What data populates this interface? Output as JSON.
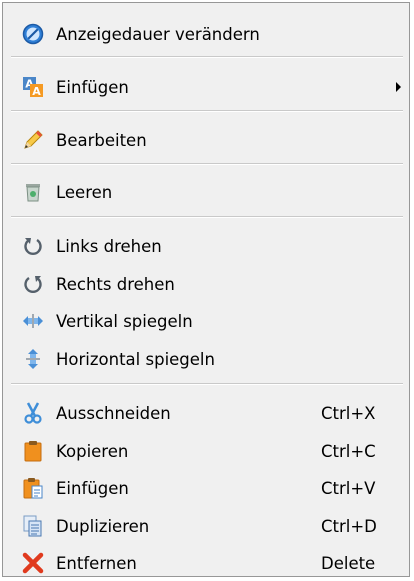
{
  "menu": {
    "items": [
      {
        "label": "Anzeigedauer verändern",
        "icon": "clock-icon"
      },
      {
        "label": "Einfügen",
        "icon": "insert-text-icon",
        "has_submenu": true
      },
      {
        "label": "Bearbeiten",
        "icon": "pencil-icon"
      },
      {
        "label": "Leeren",
        "icon": "trash-icon"
      },
      {
        "label": "Links drehen",
        "icon": "rotate-left-icon"
      },
      {
        "label": "Rechts drehen",
        "icon": "rotate-right-icon"
      },
      {
        "label": "Vertikal spiegeln",
        "icon": "flip-vertical-icon"
      },
      {
        "label": "Horizontal spiegeln",
        "icon": "flip-horizontal-icon"
      },
      {
        "label": "Ausschneiden",
        "icon": "scissors-icon",
        "shortcut": "Ctrl+X"
      },
      {
        "label": "Kopieren",
        "icon": "copy-icon",
        "shortcut": "Ctrl+C"
      },
      {
        "label": "Einfügen",
        "icon": "paste-icon",
        "shortcut": "Ctrl+V"
      },
      {
        "label": "Duplizieren",
        "icon": "duplicate-icon",
        "shortcut": "Ctrl+D"
      },
      {
        "label": "Entfernen",
        "icon": "delete-x-icon",
        "shortcut": "Delete"
      }
    ]
  }
}
